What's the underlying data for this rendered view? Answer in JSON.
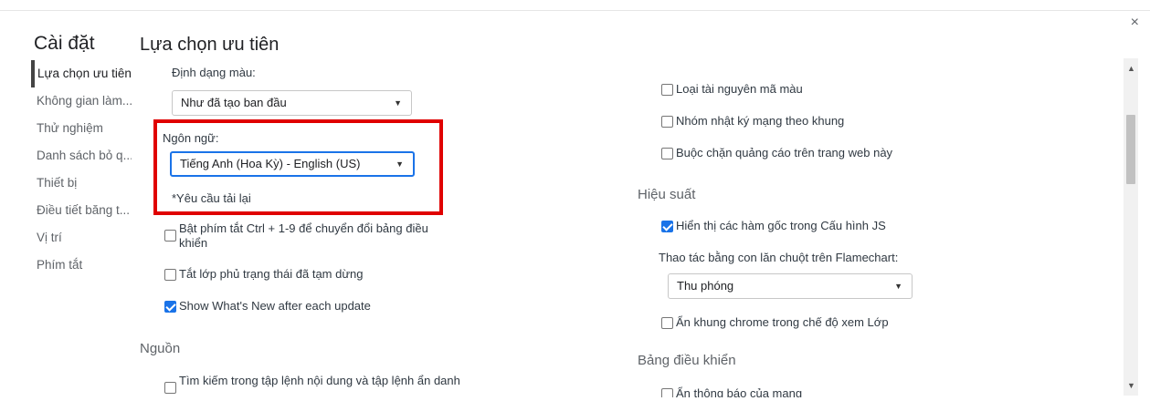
{
  "window": {
    "close_symbol": "×"
  },
  "sidebar": {
    "title": "Cài đặt",
    "items": [
      {
        "label": "Lựa chọn ưu tiên"
      },
      {
        "label": "Không gian làm..."
      },
      {
        "label": "Thử nghiệm"
      },
      {
        "label": "Danh sách bỏ q..."
      },
      {
        "label": "Thiết bị"
      },
      {
        "label": "Điều tiết băng t..."
      },
      {
        "label": "Vị trí"
      },
      {
        "label": "Phím tắt"
      }
    ]
  },
  "main": {
    "title": "Lựa chọn ưu tiên",
    "left": {
      "color_format_label": "Định dạng màu:",
      "color_format_value": "Như đã tạo ban đầu",
      "language_label": "Ngôn ngữ:",
      "language_value": "Tiếng Anh (Hoa Kỳ) - English (US)",
      "reload_note": "*Yêu cầu tải lại",
      "checkboxes": [
        {
          "label": "Bật phím tắt Ctrl + 1-9 để chuyển đổi bảng điều khiển",
          "checked": false
        },
        {
          "label": "Tắt lớp phủ trạng thái đã tạm dừng",
          "checked": false
        },
        {
          "label": "Show What's New after each update",
          "checked": true
        }
      ],
      "sources_heading": "Nguồn",
      "sources_checkbox": "Tìm kiếm trong tập lệnh nội dung và tập lệnh ẩn danh"
    },
    "right": {
      "top_checkboxes": [
        {
          "label": "Loại tài nguyên mã màu",
          "checked": false
        },
        {
          "label": "Nhóm nhật ký mạng theo khung",
          "checked": false
        },
        {
          "label": "Buộc chặn quảng cáo trên trang web này",
          "checked": false
        }
      ],
      "performance_heading": "Hiệu suất",
      "performance_checkbox": {
        "label": "Hiển thị các hàm gốc trong Cấu hình JS",
        "checked": true
      },
      "flamechart_label": "Thao tác bằng con lăn chuột trên Flamechart:",
      "flamechart_value": "Thu phóng",
      "hide_chrome_checkbox": {
        "label": "Ẩn khung chrome trong chế độ xem Lớp",
        "checked": false
      },
      "console_heading": "Bảng điều khiển",
      "console_checkbox": "Ẩn thông báo của mạng"
    }
  },
  "colors": {
    "highlight": "#e00000",
    "accent": "#1a73e8"
  }
}
